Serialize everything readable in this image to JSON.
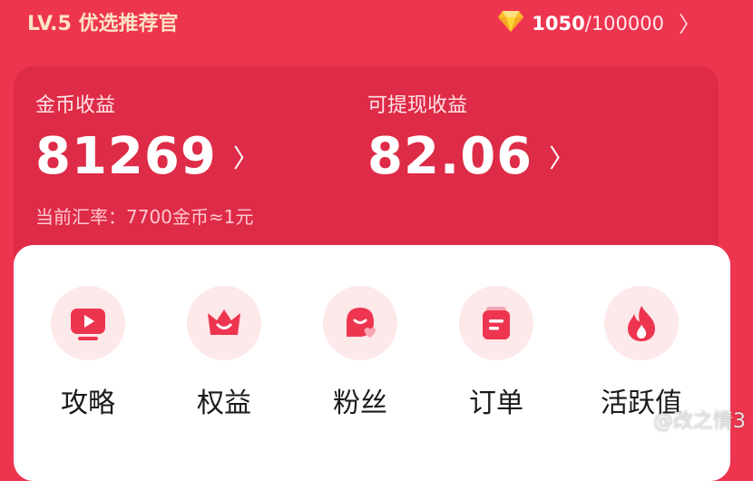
{
  "header": {
    "level": "LV.5 优选推荐官",
    "points_current": "1050",
    "points_total": "/100000"
  },
  "earnings": {
    "coin_label": "金币收益",
    "coin_value": "81269",
    "withdraw_label": "可提现收益",
    "withdraw_value": "82.06",
    "rate_text": "当前汇率：7700金币≈1元"
  },
  "menu": {
    "items": [
      {
        "label": "攻略",
        "icon": "video-play-icon"
      },
      {
        "label": "权益",
        "icon": "crown-icon"
      },
      {
        "label": "粉丝",
        "icon": "fan-heart-icon"
      },
      {
        "label": "订单",
        "icon": "order-icon"
      },
      {
        "label": "活跃值",
        "icon": "flame-icon"
      }
    ]
  },
  "watermark": "@改之情3",
  "colors": {
    "background": "#ee3550",
    "card": "#de2b47",
    "icon": "#ee3550",
    "icon_bg": "#fde8ea",
    "gem": "#fbc02d"
  }
}
